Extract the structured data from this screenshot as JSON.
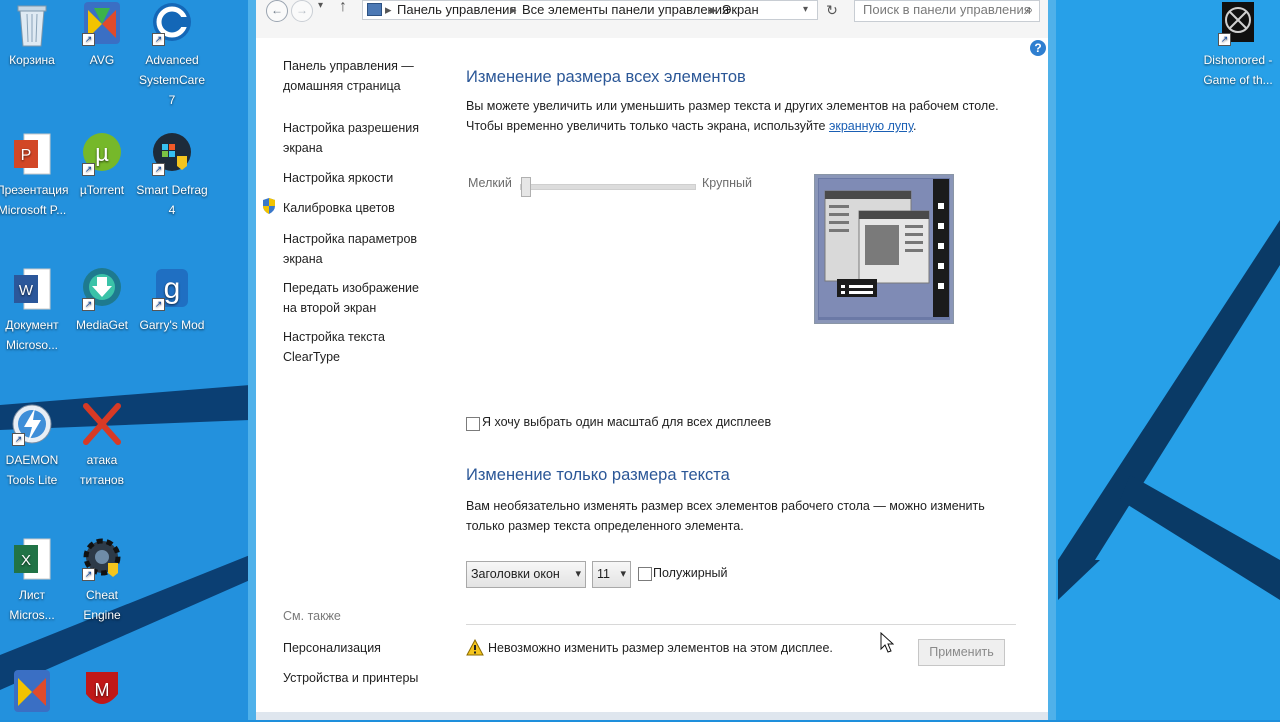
{
  "desktop": {
    "icons": [
      {
        "label": "Корзина"
      },
      {
        "label": "AVG"
      },
      {
        "label": "Advanced SystemCare 7"
      },
      {
        "label": "Презентация Microsoft P..."
      },
      {
        "label": "µTorrent"
      },
      {
        "label": "Smart Defrag 4"
      },
      {
        "label": "Документ Microso..."
      },
      {
        "label": "MediaGet"
      },
      {
        "label": "Garry's Mod"
      },
      {
        "label": "DAEMON Tools Lite"
      },
      {
        "label": "атака титанов"
      },
      {
        "label": "Лист Micros..."
      },
      {
        "label": "Cheat Engine"
      },
      {
        "label": "Dishonored - Game of th..."
      }
    ],
    "colors": {
      "background": "#1e8fdc",
      "accent": "#0f6fc0"
    }
  },
  "window": {
    "breadcrumb": [
      "Панель управления",
      "Все элементы панели управления",
      "Экран"
    ],
    "search_placeholder": "Поиск в панели управления",
    "help_glyph": "?",
    "sidebar": {
      "home": "Панель управления — домашняя страница",
      "items": [
        "Настройка разрешения экрана",
        "Настройка яркости",
        "Калибровка цветов",
        "Настройка параметров экрана",
        "Передать изображение на второй экран",
        "Настройка текста ClearType"
      ],
      "see_also": "См. также",
      "see_also_items": [
        "Персонализация",
        "Устройства и принтеры"
      ]
    },
    "resize_all": {
      "title": "Изменение размера всех элементов",
      "desc_part1": "Вы можете увеличить или уменьшить размер текста и других элементов на рабочем столе. Чтобы временно увеличить только часть экрана, используйте",
      "desc_link": "экранную лупу",
      "desc_end": ".",
      "slider_min_label": "Мелкий",
      "slider_max_label": "Крупный",
      "slider_value": 0.0,
      "checkbox_label": "Я хочу выбрать один масштаб для всех дисплеев"
    },
    "resize_text": {
      "title": "Изменение только размера текста",
      "desc": "Вам необязательно изменять размер всех элементов рабочего стола — можно изменить только размер текста определенного элемента.",
      "element_select": "Заголовки окон",
      "size_select": "11",
      "bold_label": "Полужирный"
    },
    "warning": "Невозможно изменить размер элементов на этом дисплее.",
    "apply_button": "Применить"
  }
}
